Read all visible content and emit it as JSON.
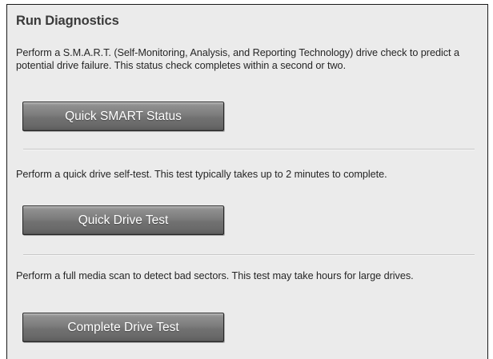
{
  "section": {
    "title": "Run Diagnostics"
  },
  "smart": {
    "description": "Perform a S.M.A.R.T. (Self-Monitoring, Analysis, and Reporting Technology) drive check to predict a potential drive failure. This status check completes within a second or two.",
    "button_label": "Quick SMART Status"
  },
  "quick_test": {
    "description": "Perform a quick drive self-test. This test typically takes up to 2 minutes to complete.",
    "button_label": "Quick Drive Test"
  },
  "complete_test": {
    "description": "Perform a full media scan to detect bad sectors. This test may take hours for large drives.",
    "button_label": "Complete Drive Test"
  }
}
